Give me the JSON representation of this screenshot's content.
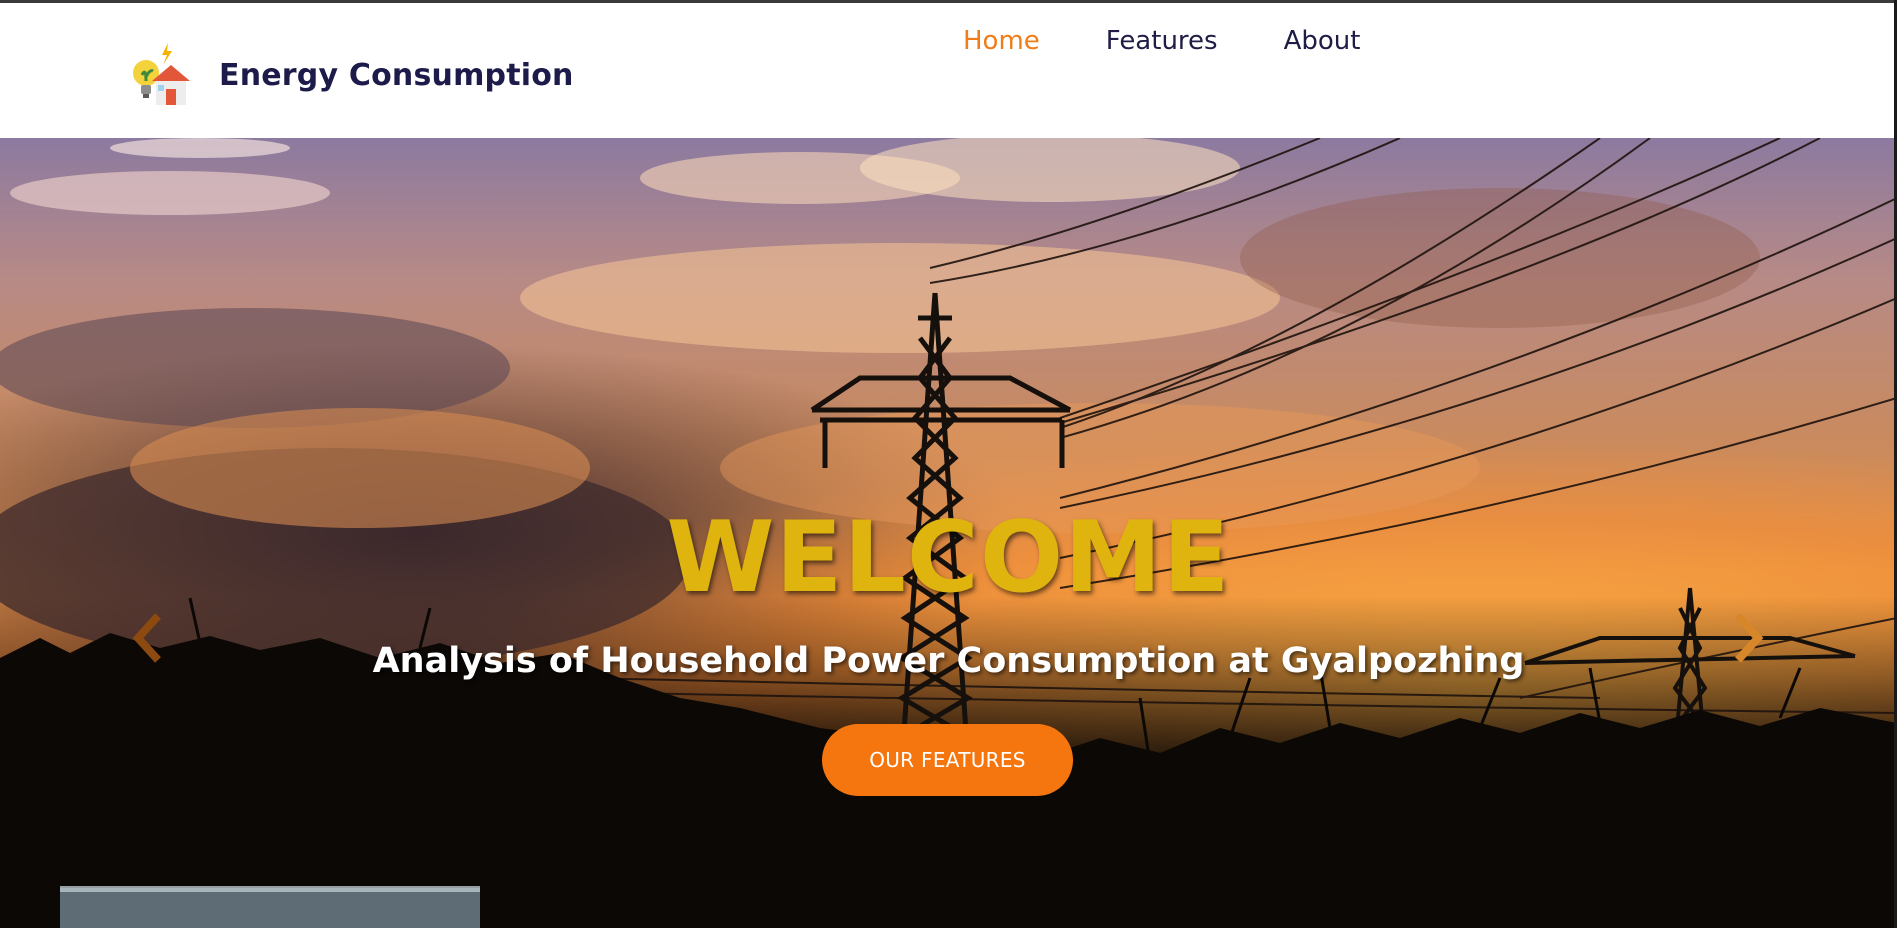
{
  "site": {
    "brand_name": "Energy Consumption",
    "logo_icon": "bulb-plant-house-logo-icon"
  },
  "nav": {
    "items": [
      {
        "label": "Home",
        "active": true
      },
      {
        "label": "Features",
        "active": false
      },
      {
        "label": "About",
        "active": false
      }
    ]
  },
  "hero": {
    "title": "WELCOME",
    "subtitle": "Analysis of Household Power Consumption at Gyalpozhing",
    "cta_label": "OUR FEATURES",
    "prev_icon": "chevron-left-icon",
    "next_icon": "chevron-right-icon"
  },
  "colors": {
    "accent": "#f07d1a",
    "cta": "#f5760f",
    "title": "#e0b40e",
    "nav_text": "#1f1d45"
  }
}
